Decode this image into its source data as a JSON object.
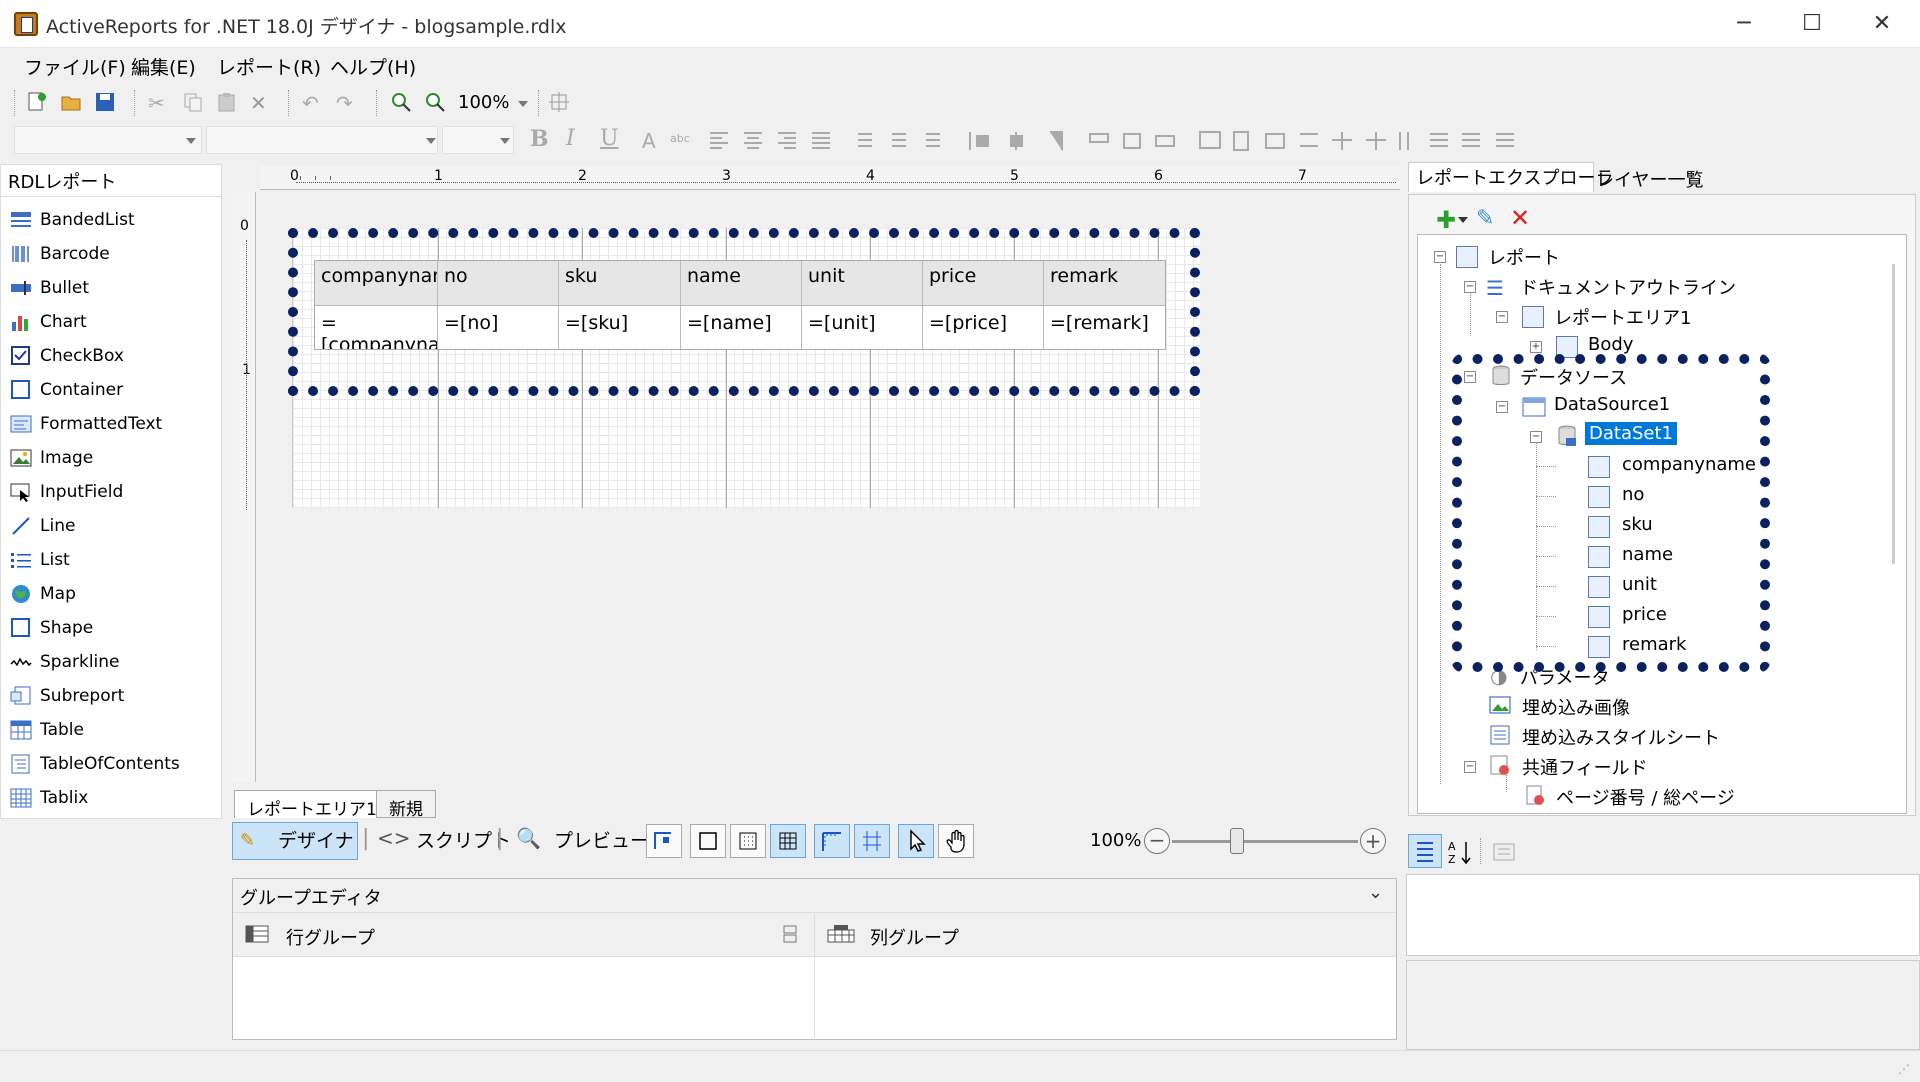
{
  "window": {
    "title": "ActiveReports for .NET 18.0J デザイナ - blogsample.rdlx",
    "minimize": "─",
    "maximize": "☐",
    "close": "✕"
  },
  "menu": [
    "ファイル(F)",
    "編集(E)",
    "レポート(R)",
    "ヘルプ(H)"
  ],
  "toolbar": {
    "zoom": "100%"
  },
  "toolbox": {
    "header": "RDLレポート",
    "items": [
      "BandedList",
      "Barcode",
      "Bullet",
      "Chart",
      "CheckBox",
      "Container",
      "FormattedText",
      "Image",
      "InputField",
      "Line",
      "List",
      "Map",
      "Shape",
      "Sparkline",
      "Subreport",
      "Table",
      "TableOfContents",
      "Tablix"
    ]
  },
  "ruler": {
    "marks": [
      "0",
      "1",
      "2",
      "3",
      "4",
      "5",
      "6",
      "7"
    ],
    "vmarks": [
      "0",
      "1"
    ]
  },
  "report_table": {
    "headers": [
      "companyname",
      "no",
      "sku",
      "name",
      "unit",
      "price",
      "remark"
    ],
    "cells": [
      "=[companyname]",
      "=[no]",
      "=[sku]",
      "=[name]",
      "=[unit]",
      "=[price]",
      "=[remark]"
    ]
  },
  "designer_tabs": [
    "レポートエリア1",
    "新規"
  ],
  "mode_bar": {
    "design": "デザイナ",
    "script": "スクリプト",
    "preview": "プレビュー",
    "zoom": "100%"
  },
  "group_editor": {
    "title": "グループエディタ",
    "row_group": "行グループ",
    "col_group": "列グループ"
  },
  "right_panel": {
    "tabs": [
      "レポートエクスプローラ",
      "レイヤー一覧"
    ],
    "tree": {
      "root": "レポート",
      "outline": "ドキュメントアウトライン",
      "area": "レポートエリア1",
      "body": "Body",
      "datasources": "データソース",
      "datasource1": "DataSource1",
      "dataset1": "DataSet1",
      "fields": [
        "companyname",
        "no",
        "sku",
        "name",
        "unit",
        "price",
        "remark"
      ],
      "parameters": "パラメータ",
      "embedded_images": "埋め込み画像",
      "embedded_styles": "埋め込みスタイルシート",
      "common_fields": "共通フィールド",
      "page_number": "ページ番号 / 総ページ"
    }
  },
  "colors": {
    "accent": "#0078d7",
    "highlight_border": "#0a2260"
  }
}
